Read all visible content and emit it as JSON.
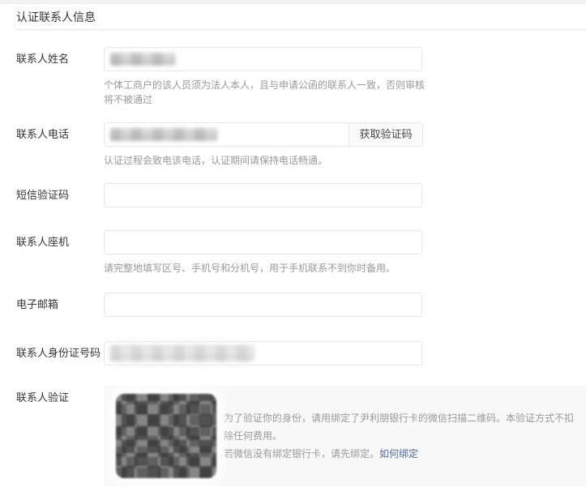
{
  "section": {
    "title": "认证联系人信息"
  },
  "fields": {
    "name": {
      "label": "联系人姓名",
      "value_state": "redacted",
      "help": "个体工商户的该人员须为法人本人，且与申请公函的联系人一致，否则审核将不被通过"
    },
    "phone": {
      "label": "联系人电话",
      "value_state": "redacted",
      "button_label": "获取验证码",
      "help": "认证过程会致电该电话，认证期间请保持电话畅通。"
    },
    "sms_code": {
      "label": "短信验证码",
      "value_state": "empty"
    },
    "landline": {
      "label": "联系人座机",
      "value_state": "empty",
      "help": "请完整地填写区号、手机号和分机号，用于手机联系不到你时备用。"
    },
    "email": {
      "label": "电子邮箱",
      "value_state": "empty"
    },
    "id_number": {
      "label": "联系人身份证号码",
      "value_state": "redacted"
    },
    "verification": {
      "label": "联系人验证",
      "qr_state": "redacted-qr-code",
      "line1": "为了验证你的身份，请用绑定了尹利朋银行卡的微信扫描二维码。本验证方式不扣除任何费用。",
      "line2": "若微信没有绑定银行卡，请先绑定。",
      "link_label": "如何绑定"
    }
  },
  "colors": {
    "label_text": "#353535",
    "help_text": "#9a9a9a",
    "border": "#e7e7eb",
    "link": "#576b95",
    "panel_bg": "#f8f8f8",
    "button_bg": "#fafafa"
  }
}
